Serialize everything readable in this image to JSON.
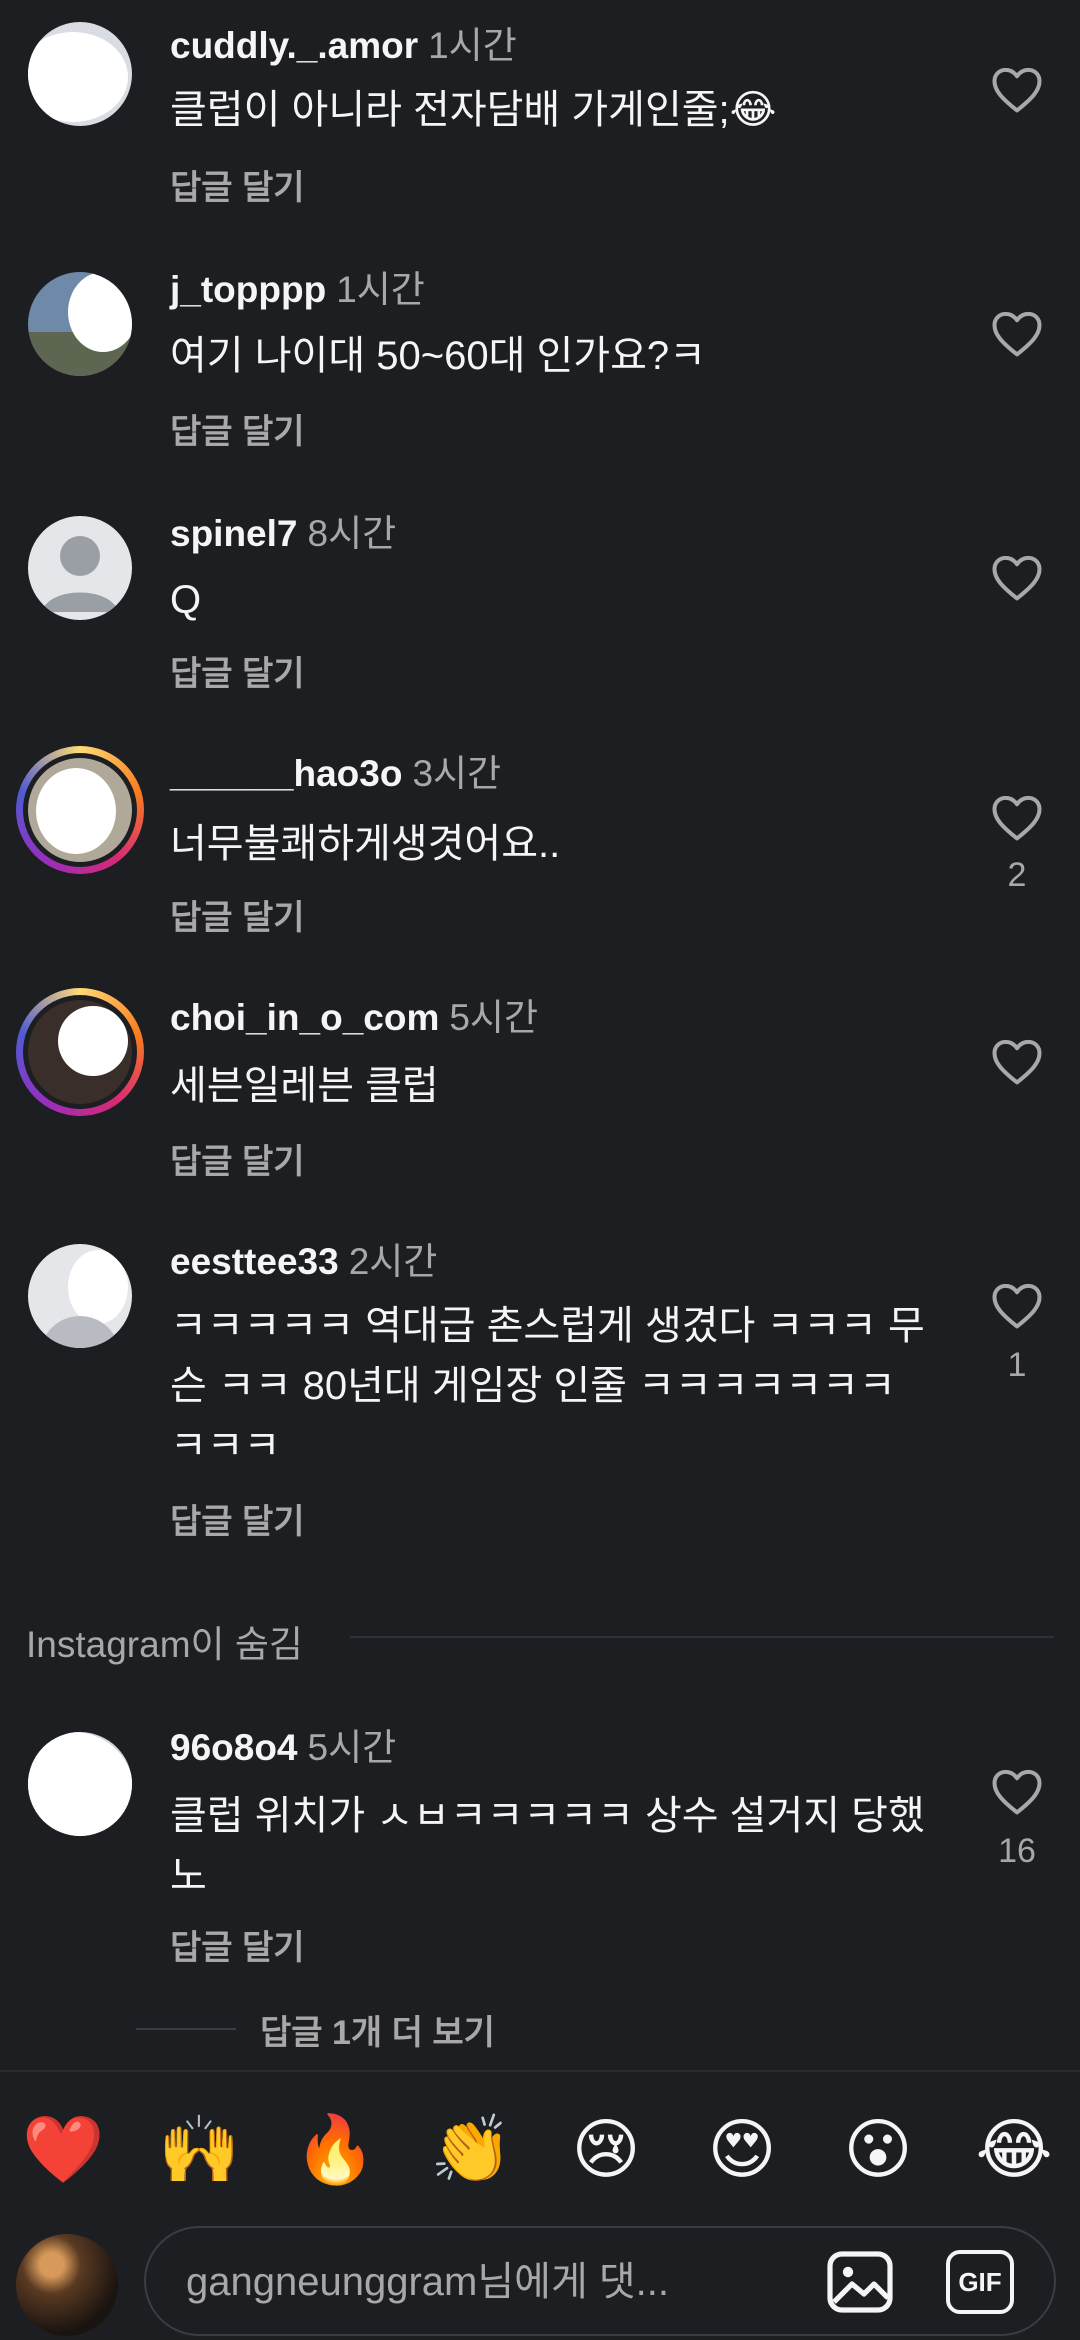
{
  "comments": [
    {
      "user": "cuddly._.amor",
      "time": "1시간",
      "text": "클럽이 아니라 전자담배 가게인줄;😂",
      "reply": "답글 달기",
      "likes": ""
    },
    {
      "user": "j_topppp",
      "time": "1시간",
      "text": "여기 나이대 50~60대 인가요?ㅋ",
      "reply": "답글 달기",
      "likes": ""
    },
    {
      "user": "spinel7",
      "time": "8시간",
      "text": "Q",
      "reply": "답글 달기",
      "likes": ""
    },
    {
      "user": "______hao3o",
      "time": "3시간",
      "text": "너무불쾌하게생겻어요..",
      "reply": "답글 달기",
      "likes": "2"
    },
    {
      "user": "choi_in_o_com",
      "time": "5시간",
      "text": "세븐일레븐 클럽",
      "reply": "답글 달기",
      "likes": ""
    },
    {
      "user": "eesttee33",
      "time": "2시간",
      "text": "ㅋㅋㅋㅋㅋ 역대급 촌스럽게 생겼다 ㅋㅋㅋ 무슨 ㅋㅋ 80년대 게임장 인줄 ㅋㅋㅋㅋㅋㅋㅋㅋㅋㅋ",
      "reply": "답글 달기",
      "likes": "1"
    },
    {
      "user": "96o8o4",
      "time": "5시간",
      "text": "클럽 위치가 ㅅㅂㅋㅋㅋㅋㅋ 상수 설거지 당했노",
      "reply": "답글 달기",
      "likes": "16"
    }
  ],
  "hidden_section_label": "Instagram이 숨김",
  "more_replies": "답글 1개 더 보기",
  "reactions": [
    "❤️",
    "🙌",
    "🔥",
    "👏",
    "😢",
    "😍",
    "😮",
    "😂"
  ],
  "composer": {
    "placeholder": "gangneunggram님에게 댓...",
    "gif_label": "GIF"
  },
  "colors": {
    "background": "#1c1e22",
    "secondary_text": "#a8a8a8",
    "primary_text": "#f5f5f5"
  }
}
